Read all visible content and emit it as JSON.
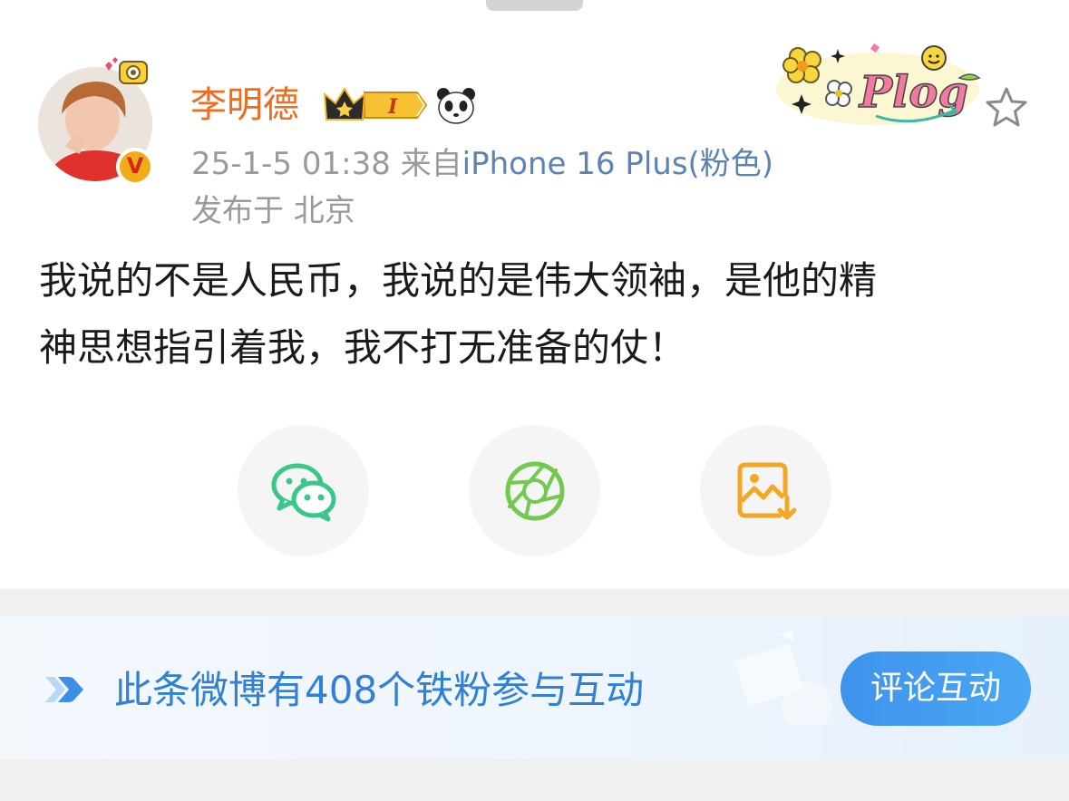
{
  "post": {
    "author": {
      "name": "李明德",
      "verified_mark": "V",
      "level_badge": "I",
      "icons": [
        "crown-badge-icon",
        "panda-icon",
        "camera-deco-icon"
      ]
    },
    "timestamp": "25-1-5 01:38",
    "source_prefix": "来自",
    "device": "iPhone 16 Plus(粉色)",
    "location": "发布于 北京",
    "decoration_sticker": "Plog",
    "text_line1": "我说的不是人民币，我说的是伟大领袖，是他的精",
    "text_line2": "神思想指引着我，我不打无准备的仗！"
  },
  "share": {
    "buttons": [
      {
        "icon": "wechat-icon",
        "color": "#3cc68a"
      },
      {
        "icon": "moments-aperture-icon",
        "color": "#72c94e"
      },
      {
        "icon": "save-image-icon",
        "color": "#f5a623"
      }
    ]
  },
  "fan_banner": {
    "text": "此条微博有408个铁粉参与互动",
    "button_label": "评论互动",
    "icons": [
      "play-arrows-icon"
    ]
  },
  "colors": {
    "username": "#ee6b20",
    "device_link": "#5b84b4",
    "meta_gray": "#9a9a9a",
    "banner_text": "#2f80d6",
    "button_blue": "#3e93ec"
  }
}
